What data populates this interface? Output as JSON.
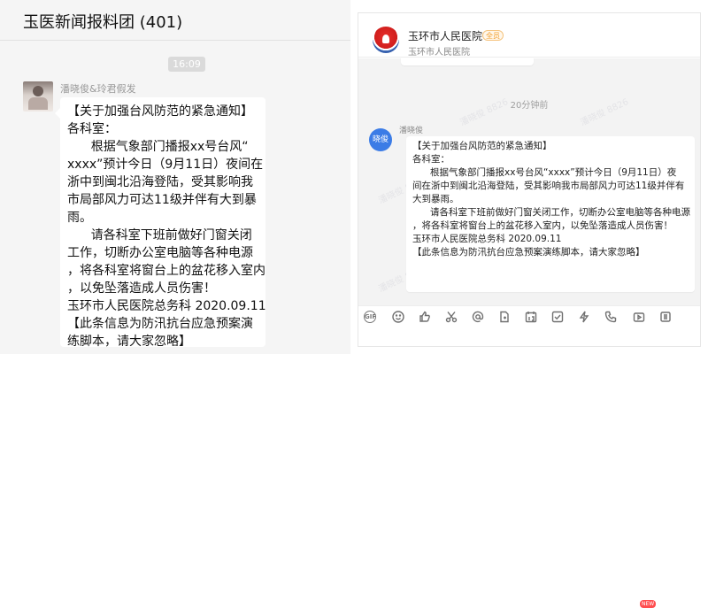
{
  "left": {
    "title": "玉医新闻报料团 (401)",
    "time": "16:09",
    "sender": "潘晓俊&玲君假发",
    "lines": [
      "【关于加强台风防范的紧急通知】",
      "各科室：",
      "      根据气象部门播报xx号台风“",
      "xxxx”预计今日（9月11日）夜间在",
      "浙中到闽北沿海登陆，受其影响我",
      "市局部风力可达11级并伴有大到暴",
      "雨。",
      "      请各科室下班前做好门窗关闭",
      "工作，切断办公室电脑等各种电源",
      "，将各科室将窗台上的盆花移入室内",
      "，以免坠落造成人员伤害！",
      "玉环市人民医院总务科 2020.09.11",
      "【此条信息为防汛抗台应急预案演",
      "练脚本，请大家忽略】"
    ]
  },
  "right": {
    "name": "玉环市人民医院",
    "badge": "全员",
    "subtitle": "玉环市人民医院",
    "time": "20分钟前",
    "avatar_text": "晓俊",
    "sender": "潘晓俊",
    "watermark": "潘晓俊 8826",
    "lines": [
      "【关于加强台风防范的紧急通知】",
      "各科室：",
      "      根据气象部门播报xx号台风“xxxx”预计今日（9月11日）夜",
      "间在浙中到闽北沿海登陆，受其影响我市局部风力可达11级并伴有",
      "大到暴雨。",
      "      请各科室下班前做好门窗关闭工作，切断办公室电脑等各种电源",
      "，将各科室将窗台上的盆花移入室内，以免坠落造成人员伤害！",
      "玉环市人民医院总务科 2020.09.11",
      "【此条信息为防汛抗台应急预案演练脚本，请大家忽略】"
    ],
    "toolbar": {
      "gif_label": "GIF",
      "new_label": "NEW",
      "icons": [
        "gif-icon",
        "emoji-icon",
        "thumbs-up-icon",
        "scissors-icon",
        "at-icon",
        "file-icon",
        "calendar-icon",
        "checkbox-icon",
        "lightning-icon",
        "video-icon",
        "more-icon"
      ]
    }
  }
}
